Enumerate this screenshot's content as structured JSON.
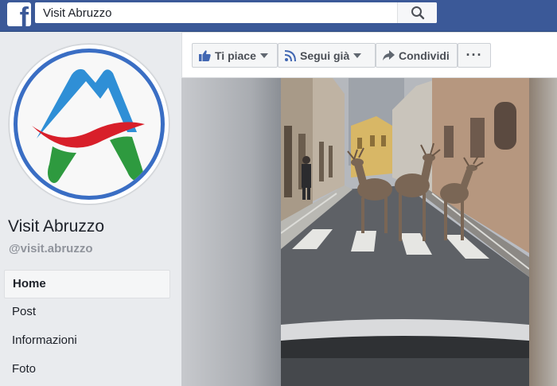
{
  "topbar": {
    "logo_letter": "f",
    "search_value": "Visit Abruzzo",
    "search_icon": "search-icon"
  },
  "page": {
    "name": "Visit Abruzzo",
    "handle": "@visit.abruzzo",
    "avatar_icon": "abruzzo-logo"
  },
  "nav": {
    "items": [
      {
        "label": "Home"
      },
      {
        "label": "Post"
      },
      {
        "label": "Informazioni"
      },
      {
        "label": "Foto"
      }
    ]
  },
  "actions": {
    "like_label": "Ti piace",
    "follow_label": "Segui già",
    "share_label": "Condividi",
    "more_label": "···"
  },
  "colors": {
    "brand": "#3b5998",
    "logo_blue": "#2f8fd6",
    "logo_red": "#d81f2a",
    "logo_green": "#2e9a3f"
  }
}
